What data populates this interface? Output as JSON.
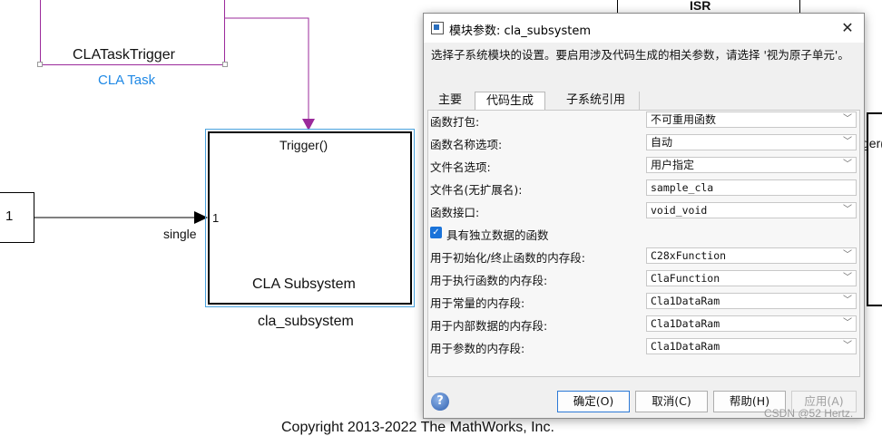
{
  "diagram": {
    "trigger_block_label": "CLATaskTrigger",
    "trigger_block_sublabel": "CLA Task",
    "subsystem_port_top": "Trigger()",
    "subsystem_port_in": "1",
    "subsystem_title": "CLA Subsystem",
    "subsystem_name": "cla_subsystem",
    "inport_value": "1",
    "signal_label": "single",
    "isr_label": "ISR",
    "right_block_partial": "ger(",
    "copyright": "Copyright 2013-2022 The MathWorks, Inc.",
    "watermark": "CSDN @52 Hertz."
  },
  "dialog": {
    "title": "模块参数: cla_subsystem",
    "close_glyph": "✕",
    "description": "选择子系统模块的设置。要启用涉及代码生成的相关参数，请选择 '视为原子单元'。",
    "tabs": [
      {
        "label": "主要"
      },
      {
        "label": "代码生成"
      },
      {
        "label": "子系统引用"
      }
    ],
    "rows": [
      {
        "label": "函数打包:",
        "value": "不可重用函数"
      },
      {
        "label": "函数名称选项:",
        "value": "自动"
      },
      {
        "label": "文件名选项:",
        "value": "用户指定"
      },
      {
        "label": "文件名(无扩展名):",
        "value": "sample_cla"
      },
      {
        "label": "函数接口:",
        "value": "void_void"
      },
      {
        "label": "具有独立数据的函数",
        "value": "checked"
      },
      {
        "label": "用于初始化/终止函数的内存段:",
        "value": "C28xFunction"
      },
      {
        "label": "用于执行函数的内存段:",
        "value": "ClaFunction"
      },
      {
        "label": "用于常量的内存段:",
        "value": "Cla1DataRam"
      },
      {
        "label": "用于内部数据的内存段:",
        "value": "Cla1DataRam"
      },
      {
        "label": "用于参数的内存段:",
        "value": "Cla1DataRam"
      }
    ],
    "buttons": {
      "ok": "确定(O)",
      "cancel": "取消(C)",
      "help": "帮助(H)",
      "apply": "应用(A)"
    },
    "help_icon_glyph": "?"
  },
  "colors": {
    "trigger_block_border": "#9b2a9b",
    "cla_task_text": "#1e88e5",
    "selection_blue": "#4aa3df",
    "checkbox_blue": "#1a73d9"
  }
}
